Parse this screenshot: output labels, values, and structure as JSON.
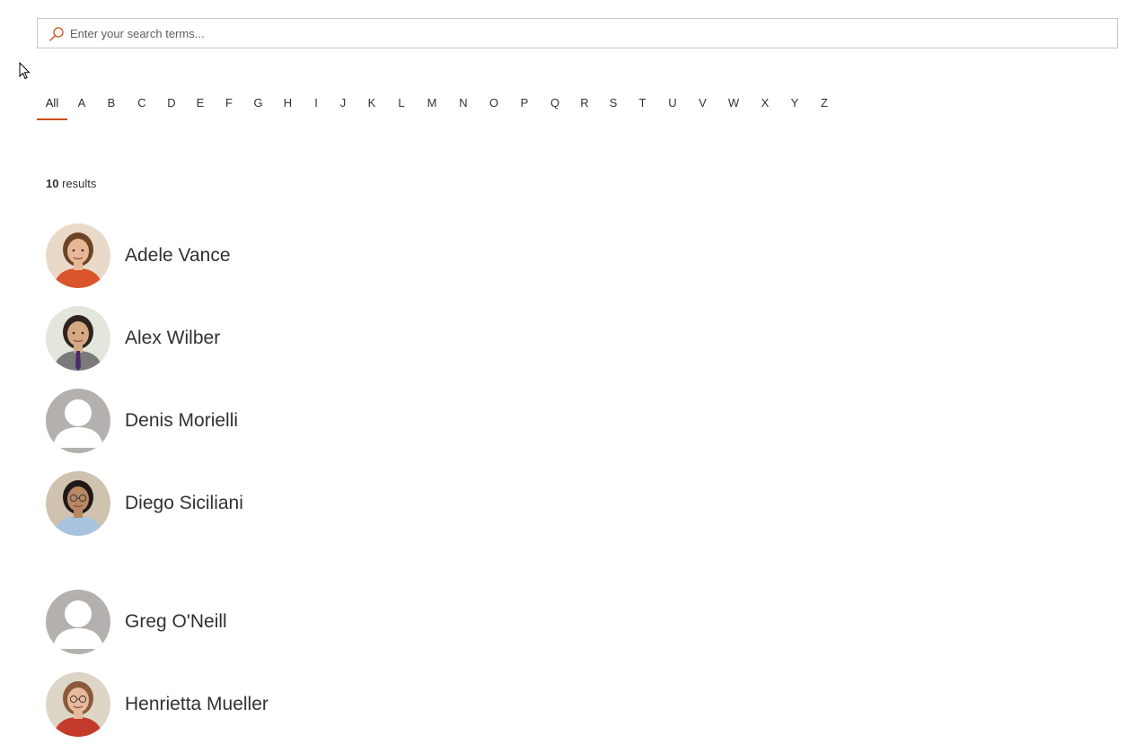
{
  "search": {
    "placeholder": "Enter your search terms...",
    "value": "",
    "icon": "search-icon"
  },
  "letters": [
    "All",
    "A",
    "B",
    "C",
    "D",
    "E",
    "F",
    "G",
    "H",
    "I",
    "J",
    "K",
    "L",
    "M",
    "N",
    "O",
    "P",
    "Q",
    "R",
    "S",
    "T",
    "U",
    "V",
    "W",
    "X",
    "Y",
    "Z"
  ],
  "active_letter": "All",
  "accent_color": "#ca5010",
  "results": {
    "count": "10",
    "label": "results"
  },
  "people": [
    {
      "name": "Adele Vance",
      "avatar": "photo-woman-brown-hair",
      "photo": true
    },
    {
      "name": "Alex Wilber",
      "avatar": "photo-man-tie",
      "photo": true
    },
    {
      "name": "Denis Morielli",
      "avatar": "default-person-avatar",
      "photo": false
    },
    {
      "name": "Diego Siciliani",
      "avatar": "photo-man-glasses",
      "photo": true
    },
    {
      "name": "Greg O'Neill",
      "avatar": "default-person-avatar",
      "photo": false
    },
    {
      "name": "Henrietta Mueller",
      "avatar": "photo-woman-glasses",
      "photo": true
    }
  ]
}
